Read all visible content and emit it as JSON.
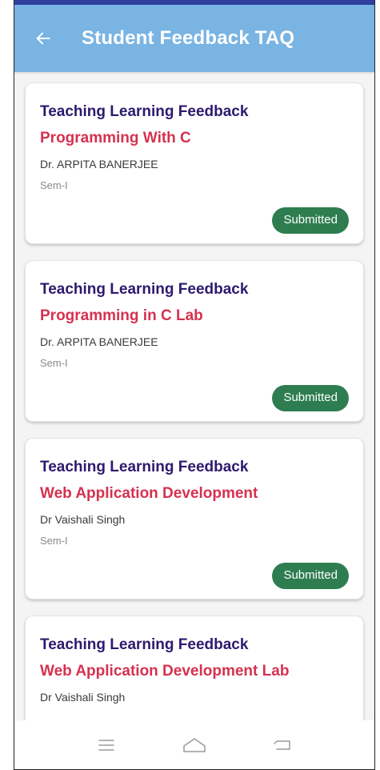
{
  "app_bar": {
    "title": "Student Feedback TAQ",
    "back_icon": "arrow-left-icon",
    "background": "#79b4e3"
  },
  "feedback_cards": [
    {
      "type": "Teaching Learning Feedback",
      "subject": "Programming With C",
      "teacher": "Dr. ARPITA BANERJEE",
      "semester": "Sem-I",
      "status": "Submitted"
    },
    {
      "type": "Teaching Learning Feedback",
      "subject": "Programming in C Lab",
      "teacher": "Dr. ARPITA BANERJEE",
      "semester": "Sem-I",
      "status": "Submitted"
    },
    {
      "type": "Teaching Learning Feedback",
      "subject": "Web Application Development",
      "teacher": "Dr Vaishali Singh",
      "semester": "Sem-I",
      "status": "Submitted"
    },
    {
      "type": "Teaching Learning Feedback",
      "subject": "Web Application Development Lab",
      "teacher": "Dr Vaishali Singh",
      "semester": "",
      "status": ""
    }
  ],
  "colors": {
    "type_text": "#2d1a6e",
    "subject_text": "#d6314f",
    "status_pill": "#2e7d50"
  },
  "nav_bar": {
    "icons": [
      "menu-icon",
      "home-icon",
      "back-icon"
    ]
  }
}
